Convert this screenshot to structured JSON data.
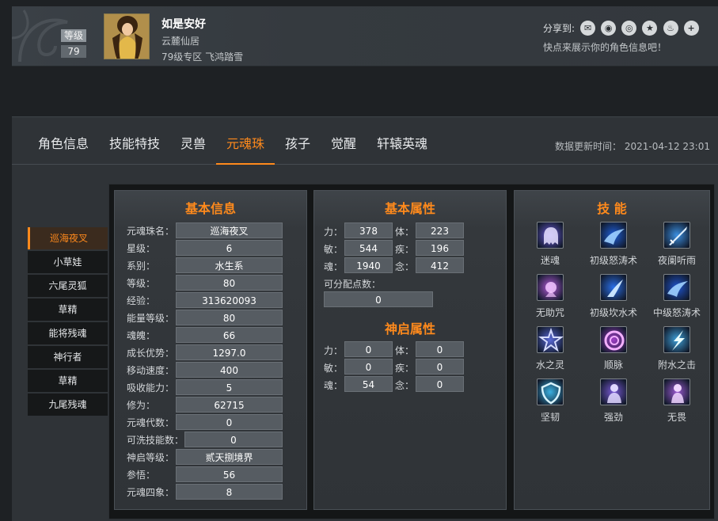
{
  "profile": {
    "level_label": "等级",
    "level_value": "79",
    "name": "如是安好",
    "guild": "云麓仙居",
    "server": "79级专区 飞鸿踏雪",
    "share_label": "分享到:",
    "share_icons": [
      "wechat-icon",
      "qq-icon",
      "weibo-icon",
      "qzone-icon",
      "tieba-icon",
      "plus-icon"
    ],
    "share_hint": "快点来展示你的角色信息吧！"
  },
  "tabs": [
    {
      "label": "角色信息",
      "active": false
    },
    {
      "label": "技能特技",
      "active": false
    },
    {
      "label": "灵兽",
      "active": false
    },
    {
      "label": "元魂珠",
      "active": true
    },
    {
      "label": "孩子",
      "active": false
    },
    {
      "label": "觉醒",
      "active": false
    },
    {
      "label": "轩辕英魂",
      "active": false
    }
  ],
  "update_time": "数据更新时间： 2021-04-12 23:01",
  "subnav": [
    {
      "label": "巡海夜叉",
      "active": true
    },
    {
      "label": "小草娃",
      "active": false
    },
    {
      "label": "六尾灵狐",
      "active": false
    },
    {
      "label": "草精",
      "active": false
    },
    {
      "label": "能将残魂",
      "active": false
    },
    {
      "label": "神行者",
      "active": false
    },
    {
      "label": "草精",
      "active": false
    },
    {
      "label": "九尾残魂",
      "active": false
    }
  ],
  "basic_info": {
    "title": "基本信息",
    "rows": [
      {
        "label": "元魂珠名：",
        "value": "巡海夜叉"
      },
      {
        "label": "星级：",
        "value": "6"
      },
      {
        "label": "系别：",
        "value": "水生系"
      },
      {
        "label": "等级：",
        "value": "80"
      },
      {
        "label": "经验：",
        "value": "313620093"
      },
      {
        "label": "能量等级：",
        "value": "80"
      },
      {
        "label": "魂魄：",
        "value": "66"
      },
      {
        "label": "成长优势：",
        "value": "1297.0"
      },
      {
        "label": "移动速度：",
        "value": "400"
      },
      {
        "label": "吸收能力：",
        "value": "5"
      },
      {
        "label": "修为：",
        "value": "62715"
      },
      {
        "label": "元魂代数：",
        "value": "0"
      },
      {
        "label": "可洗技能数：",
        "value": "0"
      },
      {
        "label": "神启等级：",
        "value": "贰天捌境界"
      },
      {
        "label": "参悟：",
        "value": "56"
      },
      {
        "label": "元魂四象：",
        "value": "8"
      }
    ]
  },
  "basic_attrs": {
    "title": "基本属性",
    "stats": [
      {
        "label": "力：",
        "value": "378"
      },
      {
        "label": "体：",
        "value": "223"
      },
      {
        "label": "敏：",
        "value": "544"
      },
      {
        "label": "疾：",
        "value": "196"
      },
      {
        "label": "魂：",
        "value": "1940"
      },
      {
        "label": "念：",
        "value": "412"
      }
    ],
    "points_label": "可分配点数：",
    "points_value": "0"
  },
  "divine_attrs": {
    "title": "神启属性",
    "stats": [
      {
        "label": "力：",
        "value": "0"
      },
      {
        "label": "体：",
        "value": "0"
      },
      {
        "label": "敏：",
        "value": "0"
      },
      {
        "label": "疾：",
        "value": "0"
      },
      {
        "label": "魂：",
        "value": "54"
      },
      {
        "label": "念：",
        "value": "0"
      }
    ]
  },
  "skills": {
    "title": "技 能",
    "items": [
      {
        "name": "迷魂",
        "icon": "ghost-icon",
        "color": "#6b5bd6"
      },
      {
        "name": "初级怒涛术",
        "icon": "wave-icon",
        "color": "#1f5fd9"
      },
      {
        "name": "夜阑听雨",
        "icon": "sword-icon",
        "color": "#3c8fe0"
      },
      {
        "name": "无助咒",
        "icon": "curse-icon",
        "color": "#b35ad8"
      },
      {
        "name": "初级坎水术",
        "icon": "water-icon",
        "color": "#2a6fe8"
      },
      {
        "name": "中级怒涛术",
        "icon": "wave-icon",
        "color": "#1f55d0"
      },
      {
        "name": "水之灵",
        "icon": "star-icon",
        "color": "#5a6ad8"
      },
      {
        "name": "顺脉",
        "icon": "swirl-icon",
        "color": "#a03fc9"
      },
      {
        "name": "附水之击",
        "icon": "lightning-icon",
        "color": "#3fa0d8"
      },
      {
        "name": "坚韧",
        "icon": "shield-icon",
        "color": "#3ab0e0"
      },
      {
        "name": "强劲",
        "icon": "warrior-icon",
        "color": "#7a5bd6"
      },
      {
        "name": "无畏",
        "icon": "fearless-icon",
        "color": "#9a5ad0"
      }
    ]
  }
}
